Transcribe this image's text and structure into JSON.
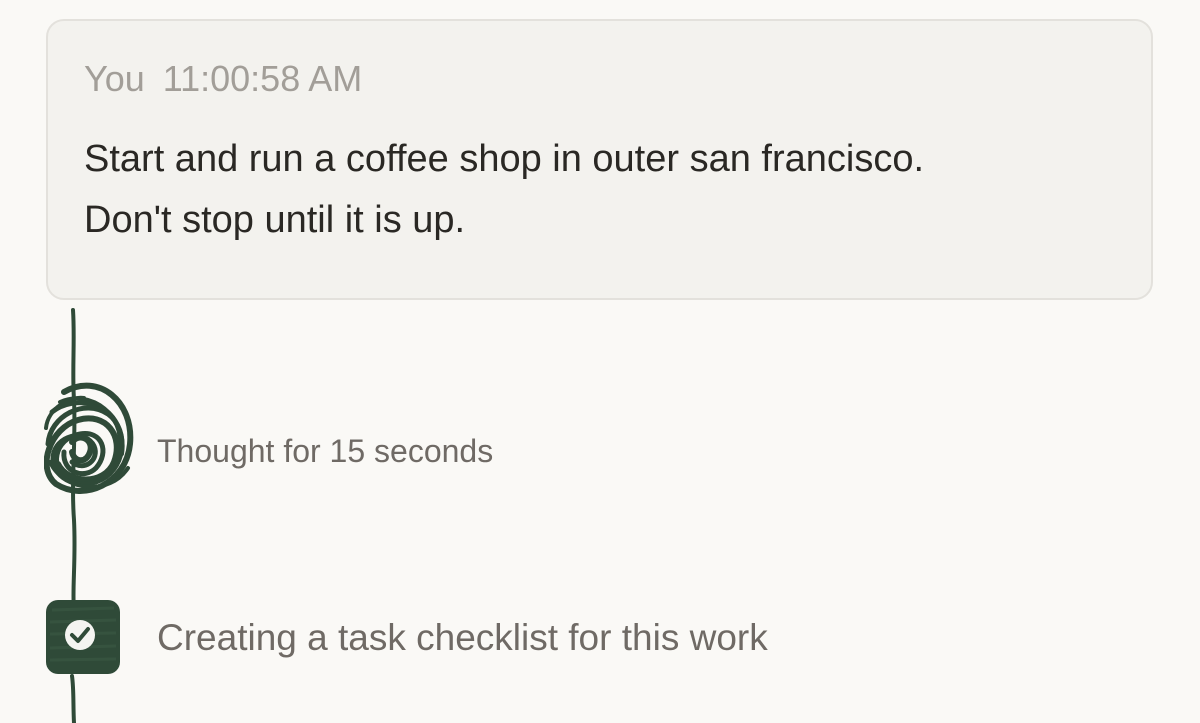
{
  "message": {
    "author": "You",
    "timestamp": "11:00:58 AM",
    "lines": [
      "Start and run a coffee shop in outer san francisco.",
      "Don't stop until it is up."
    ]
  },
  "steps": [
    {
      "icon": "scribble-thinking-icon",
      "label": "Thought for 15 seconds"
    },
    {
      "icon": "checkbox-checked-icon",
      "label": "Creating a task checklist for this work"
    }
  ],
  "colors": {
    "background": "#faf9f6",
    "card": "#f3f2ee",
    "card_border": "#e3e1dc",
    "accent_green": "#2f4a38",
    "muted_text": "#a29e98",
    "body_text": "#2a2824",
    "step_text": "#6f6a65"
  }
}
